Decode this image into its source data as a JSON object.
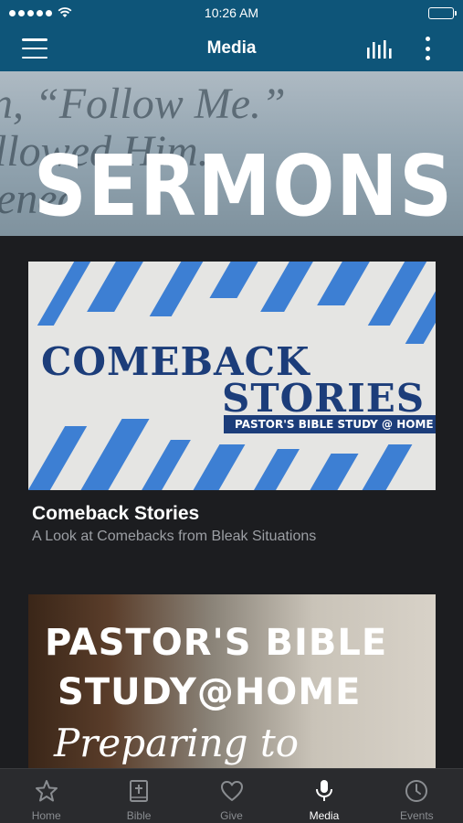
{
  "status_bar": {
    "time": "10:26 AM"
  },
  "nav": {
    "title": "Media"
  },
  "hero": {
    "title": "SERMONS",
    "background_lines": [
      "n, “Follow Me.”",
      "llowed Him.",
      "eneo"
    ]
  },
  "cards": [
    {
      "image_text": {
        "line1": "COMEBACK",
        "line2": "STORIES",
        "ribbon": "PASTOR'S BIBLE STUDY @ HOME"
      },
      "title": "Comeback Stories",
      "subtitle": "A Look at Comebacks from Bleak Situations"
    },
    {
      "image_text": {
        "line1": "PASTOR'S BIBLE",
        "line2": "STUDY@HOME",
        "line3": "Preparing to Regather"
      }
    }
  ],
  "tabs": [
    {
      "label": "Home",
      "icon": "star-icon",
      "active": false
    },
    {
      "label": "Bible",
      "icon": "bible-icon",
      "active": false
    },
    {
      "label": "Give",
      "icon": "heart-icon",
      "active": false
    },
    {
      "label": "Media",
      "icon": "microphone-icon",
      "active": true
    },
    {
      "label": "Events",
      "icon": "clock-icon",
      "active": false
    }
  ],
  "colors": {
    "header": "#0e5579",
    "background": "#1c1d20",
    "tab_bar": "#2a2b2e",
    "inactive_tab": "#8a8d91",
    "accent_blue": "#3d7fd3",
    "navy": "#1c3d7a"
  }
}
